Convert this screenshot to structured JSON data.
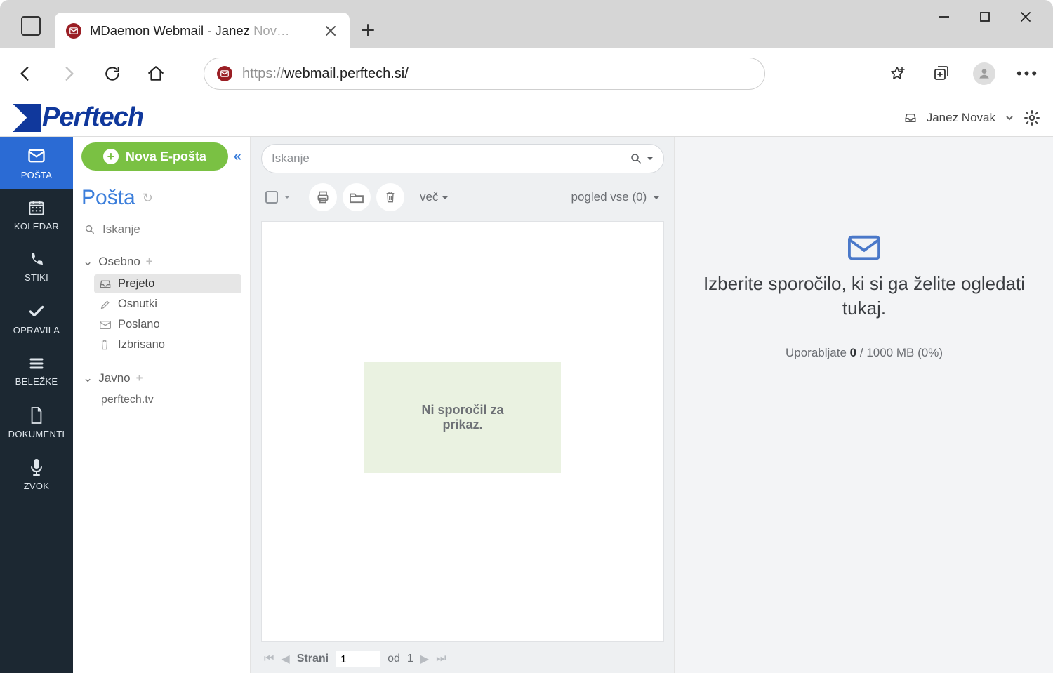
{
  "browser": {
    "tab_title_main": "MDaemon Webmail - Janez ",
    "tab_title_fade": "Nov…",
    "url_muted_prefix": "https://",
    "url_main": "webmail.perftech.si/"
  },
  "brand": {
    "name": "Perftech",
    "user_name": "Janez Novak"
  },
  "rail": {
    "items": [
      {
        "label": "POŠTA"
      },
      {
        "label": "KOLEDAR"
      },
      {
        "label": "STIKI"
      },
      {
        "label": "OPRAVILA"
      },
      {
        "label": "BELEŽKE"
      },
      {
        "label": "DOKUMENTI"
      },
      {
        "label": "ZVOK"
      }
    ]
  },
  "folders": {
    "compose_label": "Nova E-pošta",
    "pane_title": "Pošta",
    "search_label": "Iskanje",
    "group_personal": "Osebno",
    "group_public": "Javno",
    "items": {
      "inbox": "Prejeto",
      "drafts": "Osnutki",
      "sent": "Poslano",
      "trash": "Izbrisano"
    },
    "public_child": "perftech.tv"
  },
  "list": {
    "search_placeholder": "Iskanje",
    "more_label": "več",
    "view_label_prefix": "pogled vse (",
    "view_count": "0",
    "view_label_suffix": ")",
    "empty_line1": "Ni sporočil za",
    "empty_line2": "prikaz.",
    "pager_label": "Strani",
    "pager_value": "1",
    "pager_of": "od",
    "pager_total": "1"
  },
  "reading": {
    "title": "Izberite sporočilo, ki si ga želite ogledati tukaj.",
    "usage_prefix": "Uporabljate ",
    "usage_used": "0",
    "usage_sep": " / ",
    "usage_total": "1000 MB",
    "usage_pct": " (0%)"
  }
}
